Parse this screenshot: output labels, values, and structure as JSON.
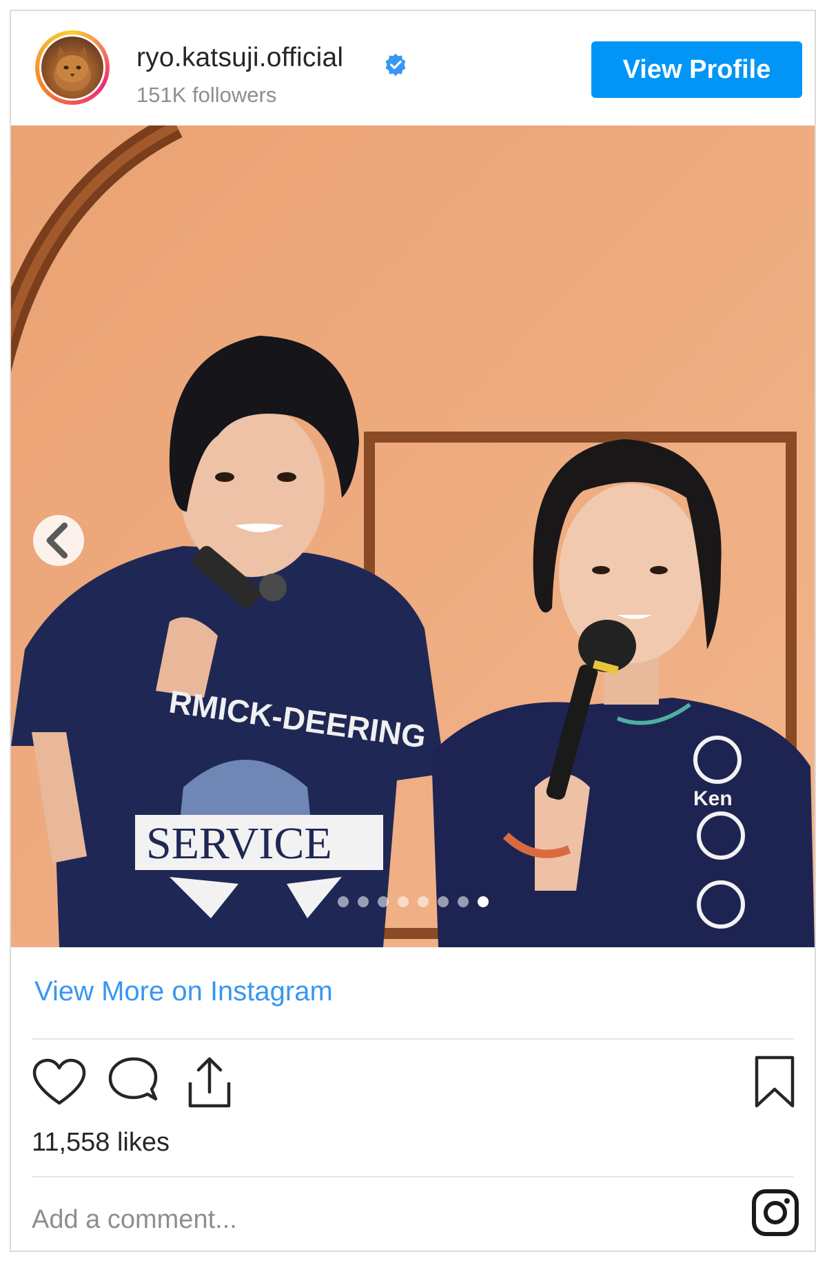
{
  "post": {
    "username": "ryo.katsuji.official",
    "followers": "151K followers",
    "view_profile_label": "View Profile",
    "view_more_label": "View More on Instagram",
    "likes": "11,558 likes",
    "comment_placeholder": "Add a comment...",
    "carousel": {
      "total_slides": 8,
      "active_slide": 8
    }
  },
  "colors": {
    "accent": "#0095f6",
    "link": "#3897f0",
    "text": "#262626",
    "muted": "#8e8e8e"
  },
  "icons": [
    "verified-badge-icon",
    "chevron-left-icon",
    "heart-icon",
    "comment-icon",
    "share-icon",
    "bookmark-icon",
    "instagram-logo-icon"
  ],
  "photo": {
    "left_shirt_print": [
      "RMICK-DEERING",
      "SERVICE"
    ],
    "right_shirt_print": "Ken"
  }
}
